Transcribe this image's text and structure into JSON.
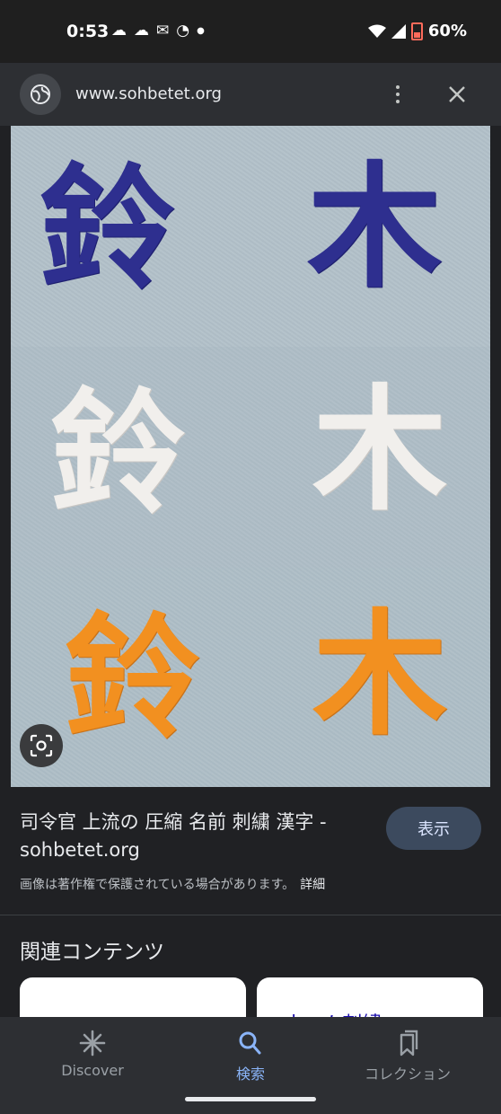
{
  "status_bar": {
    "time": "0:53",
    "battery": "60%",
    "notification_icons": [
      "cloud-sync-icon",
      "cloud-sync-icon",
      "mail-icon",
      "messenger-icon",
      "dot-icon"
    ]
  },
  "browser": {
    "url": "www.sohbetet.org",
    "site_icon": "globe-icon",
    "more_icon": "more-vert-icon",
    "close_icon": "close-icon"
  },
  "image": {
    "rows": [
      {
        "left": "鈴",
        "right": "木",
        "color": "#2e2f8f"
      },
      {
        "left": "鈴",
        "right": "木",
        "color": "#f1efec"
      },
      {
        "left": "鈴",
        "right": "木",
        "color": "#f29020"
      }
    ],
    "lens_icon": "lens-icon"
  },
  "result": {
    "title": "司令官 上流の 圧縮 名前 刺繍 漢字 - sohbetet.org",
    "notice": "画像は著作権で保護されている場合があります。",
    "details_link": "詳細",
    "show_button": "表示"
  },
  "related": {
    "title": "関連コンテンツ",
    "cards": [
      {
        "text": ""
      },
      {
        "text": "ネーム刺繍"
      }
    ]
  },
  "bottom_nav": {
    "items": [
      {
        "label": "Discover",
        "icon": "asterisk-icon",
        "active": false
      },
      {
        "label": "検索",
        "icon": "search-icon",
        "active": true
      },
      {
        "label": "コレクション",
        "icon": "collections-icon",
        "active": false
      }
    ]
  },
  "colors": {
    "background": "#202124",
    "accent": "#8ab4f8",
    "button_bg": "#3c4a5e"
  }
}
